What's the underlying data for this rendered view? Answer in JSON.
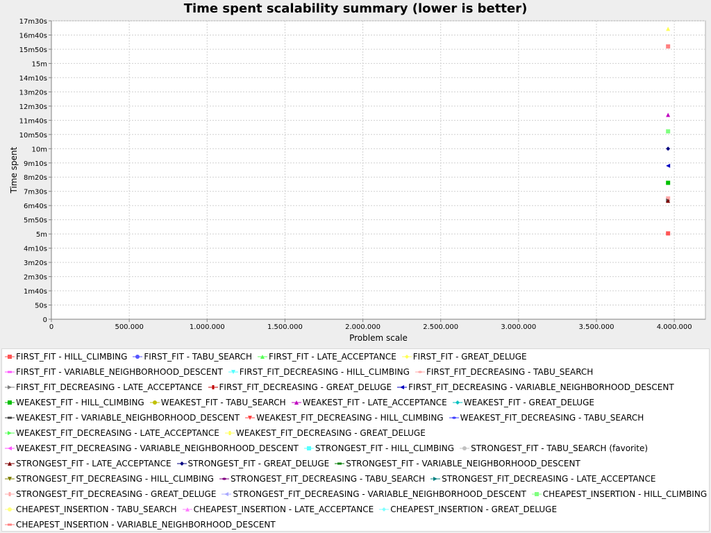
{
  "chart_data": {
    "type": "scatter",
    "title": "Time spent scalability summary (lower is better)",
    "xlabel": "Problem scale",
    "ylabel": "Time spent",
    "xlim": [
      0,
      4200000
    ],
    "ylim": [
      0,
      1050
    ],
    "grid": true,
    "legend_position": "bottom",
    "x_ticks": [
      {
        "v": 0,
        "label": "0"
      },
      {
        "v": 500000,
        "label": "500.000"
      },
      {
        "v": 1000000,
        "label": "1.000.000"
      },
      {
        "v": 1500000,
        "label": "1.500.000"
      },
      {
        "v": 2000000,
        "label": "2.000.000"
      },
      {
        "v": 2500000,
        "label": "2.500.000"
      },
      {
        "v": 3000000,
        "label": "3.000.000"
      },
      {
        "v": 3500000,
        "label": "3.500.000"
      },
      {
        "v": 4000000,
        "label": "4.000.000"
      }
    ],
    "y_ticks": [
      {
        "v": 0,
        "label": "0"
      },
      {
        "v": 50,
        "label": "50s"
      },
      {
        "v": 100,
        "label": "1m40s"
      },
      {
        "v": 150,
        "label": "2m30s"
      },
      {
        "v": 200,
        "label": "3m20s"
      },
      {
        "v": 250,
        "label": "4m10s"
      },
      {
        "v": 300,
        "label": "5m"
      },
      {
        "v": 350,
        "label": "5m50s"
      },
      {
        "v": 400,
        "label": "6m40s"
      },
      {
        "v": 450,
        "label": "7m30s"
      },
      {
        "v": 500,
        "label": "8m20s"
      },
      {
        "v": 550,
        "label": "9m10s"
      },
      {
        "v": 600,
        "label": "10m"
      },
      {
        "v": 650,
        "label": "10m50s"
      },
      {
        "v": 700,
        "label": "11m40s"
      },
      {
        "v": 750,
        "label": "12m30s"
      },
      {
        "v": 800,
        "label": "13m20s"
      },
      {
        "v": 850,
        "label": "14m10s"
      },
      {
        "v": 900,
        "label": "15m"
      },
      {
        "v": 950,
        "label": "15m50s"
      },
      {
        "v": 1000,
        "label": "16m40s"
      },
      {
        "v": 1050,
        "label": "17m30s"
      }
    ],
    "points": [
      {
        "x": 3960000,
        "y": 1022,
        "color": "#ffff55",
        "shape": "triangle"
      },
      {
        "x": 3960000,
        "y": 960,
        "color": "#ff8080",
        "shape": "square"
      },
      {
        "x": 3960000,
        "y": 719,
        "color": "#c000c0",
        "shape": "triangle"
      },
      {
        "x": 3960000,
        "y": 661,
        "color": "#80ff80",
        "shape": "square"
      },
      {
        "x": 3960000,
        "y": 600,
        "color": "#000080",
        "shape": "diamond"
      },
      {
        "x": 3960000,
        "y": 540,
        "color": "#0000c0",
        "shape": "triangle-left"
      },
      {
        "x": 3960000,
        "y": 480,
        "color": "#00c000",
        "shape": "square"
      },
      {
        "x": 3960000,
        "y": 425,
        "color": "#ffaaaa",
        "shape": "square"
      },
      {
        "x": 3960000,
        "y": 418,
        "color": "#606060",
        "shape": "triangle-right"
      },
      {
        "x": 3960000,
        "y": 417,
        "color": "#800000",
        "shape": "triangle"
      },
      {
        "x": 3960000,
        "y": 302,
        "color": "#ff5555",
        "shape": "square"
      }
    ]
  },
  "legend": {
    "rows": [
      [
        {
          "label": "FIRST_FIT - HILL_CLIMBING",
          "color": "#ff5555",
          "shape": "square"
        },
        {
          "label": "FIRST_FIT - TABU_SEARCH",
          "color": "#5555ff",
          "shape": "circle"
        },
        {
          "label": "FIRST_FIT - LATE_ACCEPTANCE",
          "color": "#55ff55",
          "shape": "triangle"
        },
        {
          "label": "FIRST_FIT - GREAT_DELUGE",
          "color": "#ffff55",
          "shape": "diamond"
        }
      ],
      [
        {
          "label": "FIRST_FIT - VARIABLE_NEIGHBORHOOD_DESCENT",
          "color": "#ff55ff",
          "shape": "rect"
        },
        {
          "label": "FIRST_FIT_DECREASING - HILL_CLIMBING",
          "color": "#55ffff",
          "shape": "triangle-down"
        },
        {
          "label": "FIRST_FIT_DECREASING - TABU_SEARCH",
          "color": "#ffaaaa",
          "shape": "ellipse"
        }
      ],
      [
        {
          "label": "FIRST_FIT_DECREASING - LATE_ACCEPTANCE",
          "color": "#808080",
          "shape": "triangle-right"
        },
        {
          "label": "FIRST_FIT_DECREASING - GREAT_DELUGE",
          "color": "#c00000",
          "shape": "vrect"
        },
        {
          "label": "FIRST_FIT_DECREASING - VARIABLE_NEIGHBORHOOD_DESCENT",
          "color": "#0000c0",
          "shape": "triangle-left"
        }
      ],
      [
        {
          "label": "WEAKEST_FIT - HILL_CLIMBING",
          "color": "#00c000",
          "shape": "square"
        },
        {
          "label": "WEAKEST_FIT - TABU_SEARCH",
          "color": "#c0c000",
          "shape": "circle"
        },
        {
          "label": "WEAKEST_FIT - LATE_ACCEPTANCE",
          "color": "#c000c0",
          "shape": "triangle"
        },
        {
          "label": "WEAKEST_FIT - GREAT_DELUGE",
          "color": "#00c0c0",
          "shape": "diamond"
        }
      ],
      [
        {
          "label": "WEAKEST_FIT - VARIABLE_NEIGHBORHOOD_DESCENT",
          "color": "#404040",
          "shape": "rect"
        },
        {
          "label": "WEAKEST_FIT_DECREASING - HILL_CLIMBING",
          "color": "#ff4040",
          "shape": "triangle-down"
        },
        {
          "label": "WEAKEST_FIT_DECREASING - TABU_SEARCH",
          "color": "#4040ff",
          "shape": "ellipse"
        }
      ],
      [
        {
          "label": "WEAKEST_FIT_DECREASING - LATE_ACCEPTANCE",
          "color": "#55ff55",
          "shape": "triangle-right"
        },
        {
          "label": "WEAKEST_FIT_DECREASING - GREAT_DELUGE",
          "color": "#ffff55",
          "shape": "vrect"
        }
      ],
      [
        {
          "label": "WEAKEST_FIT_DECREASING - VARIABLE_NEIGHBORHOOD_DESCENT",
          "color": "#ff55ff",
          "shape": "triangle-left"
        },
        {
          "label": "STRONGEST_FIT - HILL_CLIMBING",
          "color": "#55ffff",
          "shape": "square"
        },
        {
          "label": "STRONGEST_FIT - TABU_SEARCH (favorite)",
          "color": "#c0c0c0",
          "shape": "circle"
        }
      ],
      [
        {
          "label": "STRONGEST_FIT - LATE_ACCEPTANCE",
          "color": "#800000",
          "shape": "triangle"
        },
        {
          "label": "STRONGEST_FIT - GREAT_DELUGE",
          "color": "#000080",
          "shape": "diamond"
        },
        {
          "label": "STRONGEST_FIT - VARIABLE_NEIGHBORHOOD_DESCENT",
          "color": "#008000",
          "shape": "rect"
        }
      ],
      [
        {
          "label": "STRONGEST_FIT_DECREASING - HILL_CLIMBING",
          "color": "#808000",
          "shape": "triangle-down"
        },
        {
          "label": "STRONGEST_FIT_DECREASING - TABU_SEARCH",
          "color": "#800080",
          "shape": "ellipse"
        },
        {
          "label": "STRONGEST_FIT_DECREASING - LATE_ACCEPTANCE",
          "color": "#008080",
          "shape": "triangle-right"
        }
      ],
      [
        {
          "label": "STRONGEST_FIT_DECREASING - GREAT_DELUGE",
          "color": "#ffaaaa",
          "shape": "vrect"
        },
        {
          "label": "STRONGEST_FIT_DECREASING - VARIABLE_NEIGHBORHOOD_DESCENT",
          "color": "#aaaaff",
          "shape": "triangle-left"
        },
        {
          "label": "CHEAPEST_INSERTION - HILL_CLIMBING",
          "color": "#80ff80",
          "shape": "square"
        }
      ],
      [
        {
          "label": "CHEAPEST_INSERTION - TABU_SEARCH",
          "color": "#ffff80",
          "shape": "circle"
        },
        {
          "label": "CHEAPEST_INSERTION - LATE_ACCEPTANCE",
          "color": "#ff80ff",
          "shape": "triangle"
        },
        {
          "label": "CHEAPEST_INSERTION - GREAT_DELUGE",
          "color": "#80ffff",
          "shape": "diamond"
        }
      ],
      [
        {
          "label": "CHEAPEST_INSERTION - VARIABLE_NEIGHBORHOOD_DESCENT",
          "color": "#ff8080",
          "shape": "rect"
        }
      ]
    ]
  }
}
